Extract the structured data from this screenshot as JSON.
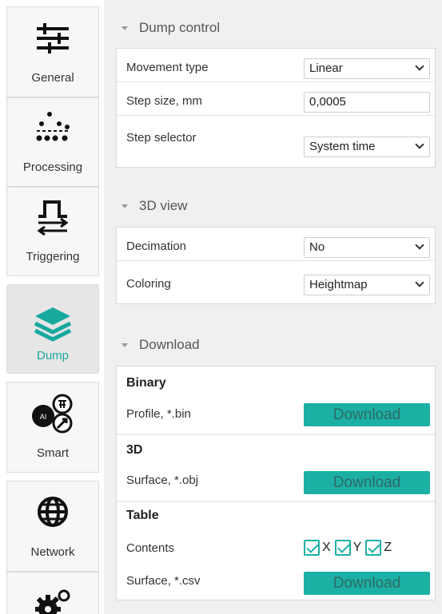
{
  "sidebar": {
    "tabs": [
      {
        "label": "General",
        "icon": "sliders-icon"
      },
      {
        "label": "Processing",
        "icon": "points-icon"
      },
      {
        "label": "Triggering",
        "icon": "trigger-pulse-icon"
      },
      {
        "label": "Dump",
        "icon": "layers-icon"
      },
      {
        "label": "Smart",
        "icon": "smart-icon"
      },
      {
        "label": "Network",
        "icon": "globe-icon"
      },
      {
        "label": "",
        "icon": "gears-icon"
      }
    ],
    "active_color": "#17a89e"
  },
  "dump_control": {
    "title": "Dump control",
    "movement_type": {
      "label": "Movement type",
      "value": "Linear"
    },
    "step_size": {
      "label": "Step size, mm",
      "value": "0,0005"
    },
    "step_selector": {
      "label": "Step selector",
      "value": "System time"
    }
  },
  "view3d": {
    "title": "3D view",
    "decimation": {
      "label": "Decimation",
      "value": "No"
    },
    "coloring": {
      "label": "Coloring",
      "value": "Heightmap"
    }
  },
  "download": {
    "title": "Download",
    "binary": {
      "heading": "Binary",
      "label": "Profile, *.bin",
      "button": "Download"
    },
    "threed": {
      "heading": "3D",
      "label": "Surface, *.obj",
      "button": "Download"
    },
    "table": {
      "heading": "Table",
      "contents_label": "Contents",
      "checks": [
        {
          "label": "X",
          "checked": true
        },
        {
          "label": "Y",
          "checked": true
        },
        {
          "label": "Z",
          "checked": true
        }
      ],
      "label": "Surface, *.csv",
      "button": "Download"
    }
  },
  "accent_color": "#1cb0a5"
}
